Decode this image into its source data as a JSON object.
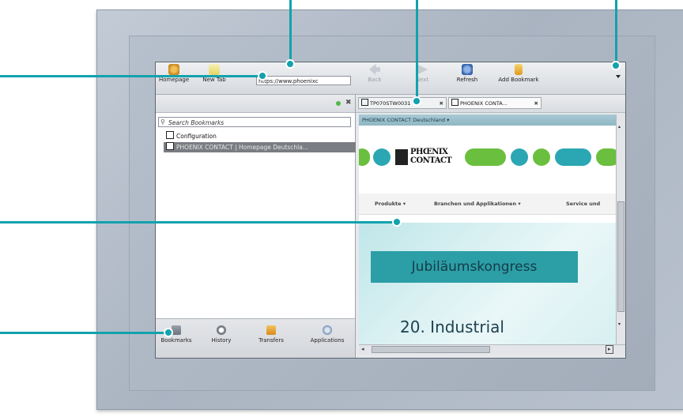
{
  "toolbar": {
    "homepage_label": "Homepage",
    "newtab_label": "New Tab",
    "url_value": "https://www.phoenixc",
    "back_label": "Back",
    "next_label": "Next",
    "refresh_label": "Refresh",
    "add_bookmark_label": "Add Bookmark"
  },
  "sidebar": {
    "search_placeholder": "Search Bookmarks",
    "bookmarks": [
      {
        "label": "Configuration"
      },
      {
        "label": "PHOENIX CONTACT | Homepage Deutschla..."
      }
    ],
    "nav": [
      {
        "label": "Bookmarks",
        "icon": "bookmarks-icon"
      },
      {
        "label": "History",
        "icon": "history-icon"
      },
      {
        "label": "Transfers",
        "icon": "transfers-icon"
      },
      {
        "label": "Applications",
        "icon": "applications-icon"
      }
    ]
  },
  "tabs": [
    {
      "label": "TP070STW0031"
    },
    {
      "label": "PHOENIX CONTA..."
    }
  ],
  "web": {
    "site_bar": "PHOENIX CONTACT Deutschland",
    "logo_line1": "PHŒNIX",
    "logo_line2": "CONTACT",
    "menu": [
      "Produkte",
      "Branchen und Applikationen",
      "Service und"
    ],
    "banner_title": "Jubiläumskongress",
    "banner_sub": "20. Industrial"
  },
  "misc": {
    "edge_text": "e"
  },
  "colors": {
    "callout": "#12a2ae",
    "selected_row": "#7a7d82",
    "kongress_bg": "#2c9ea6"
  }
}
